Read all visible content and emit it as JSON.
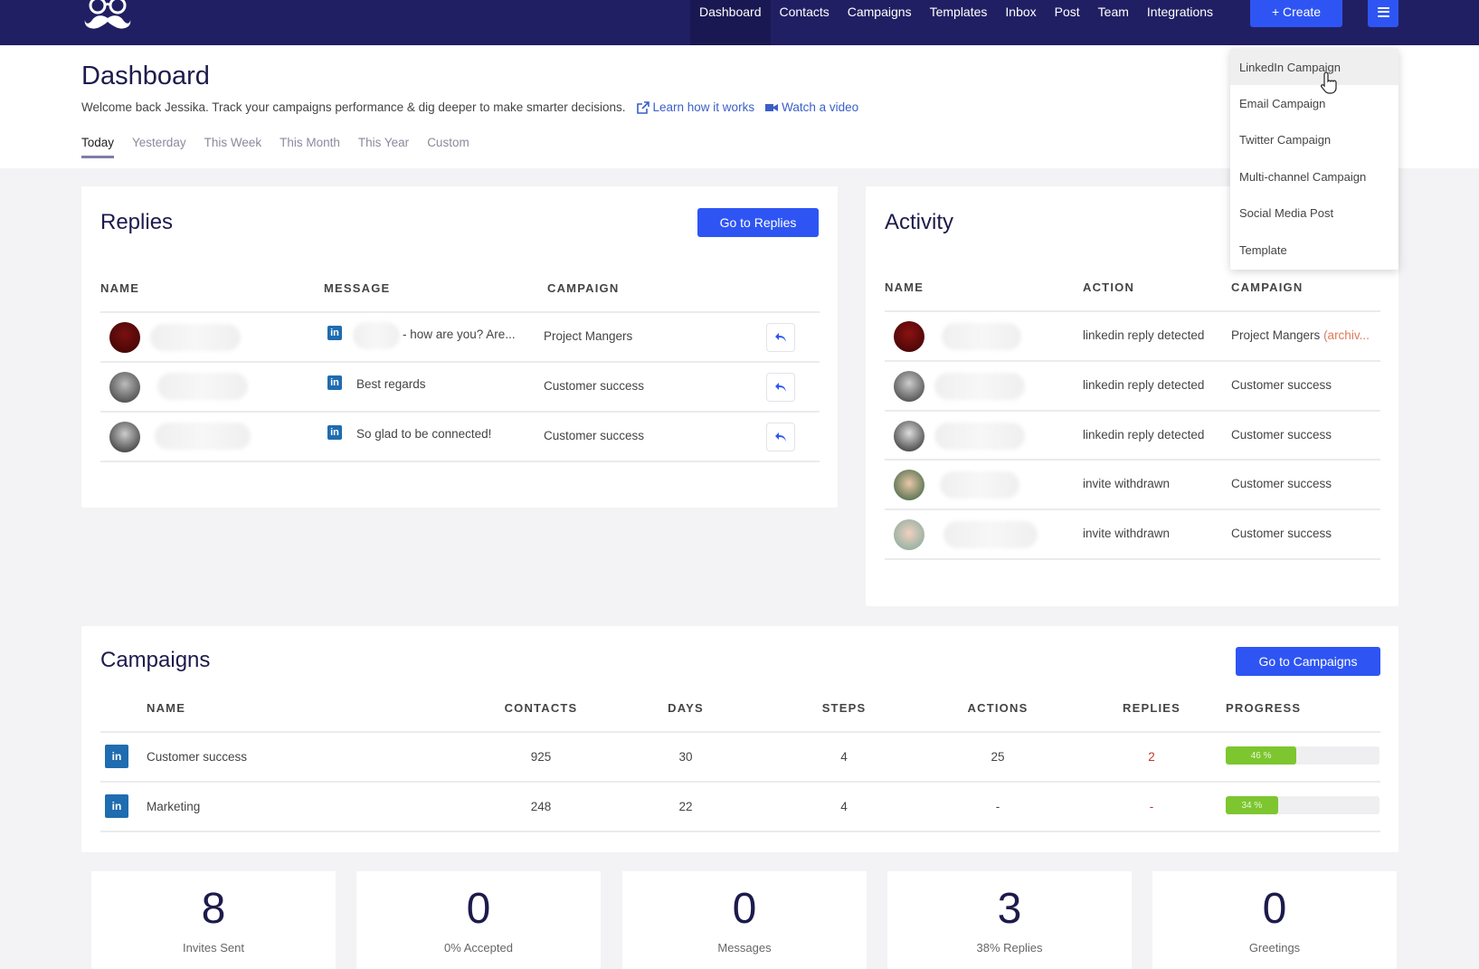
{
  "nav": {
    "items": [
      "Dashboard",
      "Contacts",
      "Campaigns",
      "Templates",
      "Inbox",
      "Post",
      "Team",
      "Integrations"
    ],
    "active": "Dashboard",
    "create_label": "+ Create",
    "logo_icon": "glasses-mustache-logo",
    "menu_icon": "hamburger-icon"
  },
  "header": {
    "title": "Dashboard",
    "welcome": "Welcome back Jessika. Track your campaigns performance & dig deeper to make smarter decisions.",
    "learn_link": "Learn how it works",
    "video_link": "Watch a video",
    "tabs": [
      "Today",
      "Yesterday",
      "This Week",
      "This Month",
      "This Year",
      "Custom"
    ],
    "active_tab": "Today"
  },
  "create_menu": {
    "items": [
      "LinkedIn Campaign",
      "Email Campaign",
      "Twitter Campaign",
      "Multi-channel Campaign",
      "Social Media Post",
      "Template"
    ],
    "hovered": "LinkedIn Campaign"
  },
  "replies": {
    "title": "Replies",
    "button": "Go to Replies",
    "columns": [
      "NAME",
      "MESSAGE",
      "CAMPAIGN"
    ],
    "rows": [
      {
        "message": "- how are you?   Are...",
        "campaign": "Project Mangers",
        "channel": "linkedin"
      },
      {
        "message": "Best regards",
        "campaign": "Customer success",
        "channel": "linkedin"
      },
      {
        "message": "So glad to be connected!",
        "campaign": "Customer success",
        "channel": "linkedin"
      }
    ]
  },
  "activity": {
    "title": "Activity",
    "columns": [
      "NAME",
      "ACTION",
      "CAMPAIGN"
    ],
    "rows": [
      {
        "action": "linkedin reply detected",
        "campaign": "Project Mangers",
        "suffix": "(archiv..."
      },
      {
        "action": "linkedin reply detected",
        "campaign": "Customer success",
        "suffix": ""
      },
      {
        "action": "linkedin reply detected",
        "campaign": "Customer success",
        "suffix": ""
      },
      {
        "action": "invite withdrawn",
        "campaign": "Customer success",
        "suffix": ""
      },
      {
        "action": "invite withdrawn",
        "campaign": "Customer success",
        "suffix": ""
      }
    ]
  },
  "campaigns": {
    "title": "Campaigns",
    "button": "Go to Campaigns",
    "columns": [
      "NAME",
      "CONTACTS",
      "DAYS",
      "STEPS",
      "ACTIONS",
      "REPLIES",
      "PROGRESS"
    ],
    "rows": [
      {
        "icon": "in",
        "name": "Customer success",
        "contacts": "925",
        "days": "30",
        "steps": "4",
        "actions": "25",
        "replies": "2",
        "progress": 46,
        "progress_label": "46 %"
      },
      {
        "icon": "in",
        "name": "Marketing",
        "contacts": "248",
        "days": "22",
        "steps": "4",
        "actions": "-",
        "replies": "-",
        "progress": 34,
        "progress_label": "34 %"
      }
    ]
  },
  "stats": [
    {
      "value": "8",
      "label": "Invites Sent"
    },
    {
      "value": "0",
      "label": "0% Accepted"
    },
    {
      "value": "0",
      "label": "Messages"
    },
    {
      "value": "3",
      "label": "38% Replies"
    },
    {
      "value": "0",
      "label": "Greetings"
    }
  ],
  "colors": {
    "nav_bg": "#211f63",
    "accent": "#2e55f3",
    "linkedin": "#1f6cb0",
    "progress": "#7dc630",
    "archived": "#e07a5a",
    "replies_count": "#c0392b"
  }
}
